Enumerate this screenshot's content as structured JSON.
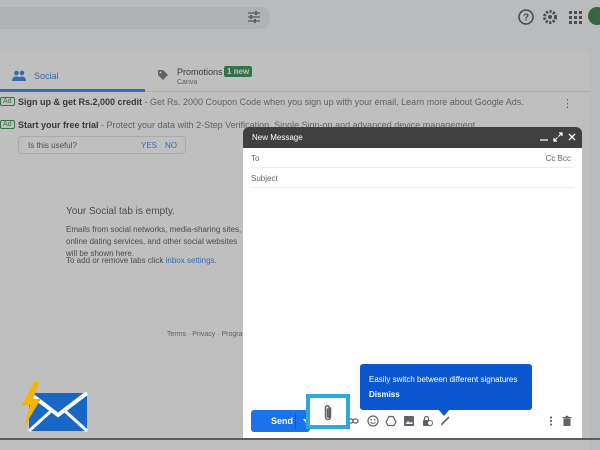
{
  "tabs": {
    "social": "Social",
    "promotions": "Promotions",
    "promotions_badge": "1 new",
    "promotions_sub": "Canva"
  },
  "ads": [
    {
      "badge": "Ad",
      "title": "Sign up & get Rs.2,000 credit",
      "text": " - Get Rs. 2000 Coupon Code when you sign up with your email. Learn more about Google Ads."
    },
    {
      "badge": "Ad",
      "title": "Start your free trial",
      "text": " - Protect your data with 2-Step Verification, Single Sign-on and advanced device management"
    }
  ],
  "feedback": {
    "question": "Is this useful?",
    "yes": "YES",
    "no": "NO"
  },
  "empty": {
    "title": "Your Social tab is empty.",
    "desc": "Emails from social networks, media-sharing sites, online dating services, and other social websites will be shown here.",
    "settings_prefix": "To add or remove tabs click ",
    "settings_link": "inbox settings",
    "settings_suffix": "."
  },
  "footer": "Terms · Privacy · Program Policies",
  "compose": {
    "title": "New Message",
    "to_label": "To",
    "ccbcc": "Cc Bcc",
    "subject_label": "Subject",
    "send_label": "Send"
  },
  "tooltip": {
    "text": "Easily switch between different signatures",
    "dismiss": "Dismiss"
  },
  "colors": {
    "accent": "#1a73e8",
    "tooltip": "#0b57d0",
    "compose_header": "#404040",
    "highlight_border": "#2aa6e0"
  }
}
